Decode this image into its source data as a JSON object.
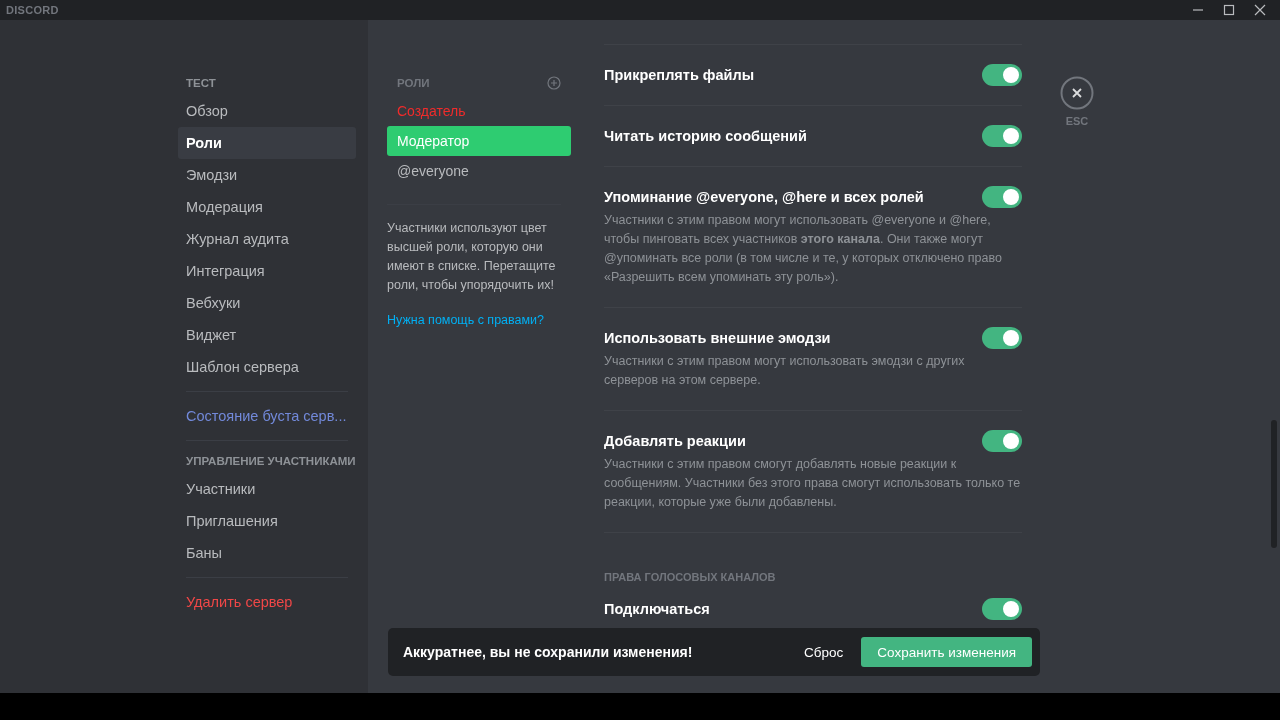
{
  "window": {
    "title": "DISCORD"
  },
  "sidebar": {
    "sections": [
      {
        "header": "ТЕСТ",
        "items": [
          {
            "label": "Обзор",
            "kind": "item",
            "selected": false
          },
          {
            "label": "Роли",
            "kind": "item",
            "selected": true
          },
          {
            "label": "Эмодзи",
            "kind": "item",
            "selected": false
          },
          {
            "label": "Модерация",
            "kind": "item",
            "selected": false
          },
          {
            "label": "Журнал аудита",
            "kind": "item",
            "selected": false
          },
          {
            "label": "Интеграция",
            "kind": "item",
            "selected": false
          },
          {
            "label": "Вебхуки",
            "kind": "item",
            "selected": false
          },
          {
            "label": "Виджет",
            "kind": "item",
            "selected": false
          },
          {
            "label": "Шаблон сервера",
            "kind": "item",
            "selected": false
          }
        ]
      },
      {
        "items": [
          {
            "label": "Состояние буста серв...",
            "kind": "boost",
            "selected": false
          }
        ]
      },
      {
        "header": "УПРАВЛЕНИЕ УЧАСТНИКАМИ",
        "items": [
          {
            "label": "Участники",
            "kind": "item",
            "selected": false
          },
          {
            "label": "Приглашения",
            "kind": "item",
            "selected": false
          },
          {
            "label": "Баны",
            "kind": "item",
            "selected": false
          }
        ]
      },
      {
        "items": [
          {
            "label": "Удалить сервер",
            "kind": "danger",
            "selected": false
          }
        ]
      }
    ]
  },
  "roles": {
    "header": "РОЛИ",
    "items": [
      {
        "name": "Создатель",
        "color": "#f02b2b",
        "selected": false
      },
      {
        "name": "Модератор",
        "color": "#2ecc71",
        "selected": true
      },
      {
        "name": "@everyone",
        "color": "#b9bbbe",
        "selected": false
      }
    ],
    "description": "Участники используют цвет высшей роли, которую они имеют в списке. Перетащите роли, чтобы упорядочить их!",
    "help_link": "Нужна помощь с правами?"
  },
  "permissions": [
    {
      "kind": "toggle",
      "title": "Прикреплять файлы",
      "on": true
    },
    {
      "kind": "toggle",
      "title": "Читать историю сообщений",
      "on": true
    },
    {
      "kind": "toggle",
      "title": "Упоминание @everyone, @here и всех ролей",
      "on": true,
      "description": "Участники с этим правом могут использовать @everyone и @here, чтобы пинговать всех участников **этого канала**. Они также могут @упоминать все роли (в том числе и те, у которых отключено право «Разрешить всем упоминать эту роль»)."
    },
    {
      "kind": "toggle",
      "title": "Использовать внешние эмодзи",
      "on": true,
      "description": "Участники с этим правом могут использовать эмодзи с других серверов на этом сервере."
    },
    {
      "kind": "toggle",
      "title": "Добавлять реакции",
      "on": true,
      "description": "Участники с этим правом смогут добавлять новые реакции к сообщениям. Участники без этого права смогут использовать только те реакции, которые уже были добавлены."
    },
    {
      "kind": "section",
      "title": "ПРАВА ГОЛОСОВЫХ КАНАЛОВ"
    },
    {
      "kind": "toggle",
      "title": "Подключаться",
      "on": true
    }
  ],
  "close": {
    "label": "ESC"
  },
  "save_bar": {
    "message": "Аккуратнее, вы не сохранили изменения!",
    "reset": "Сброс",
    "save": "Сохранить изменения"
  }
}
